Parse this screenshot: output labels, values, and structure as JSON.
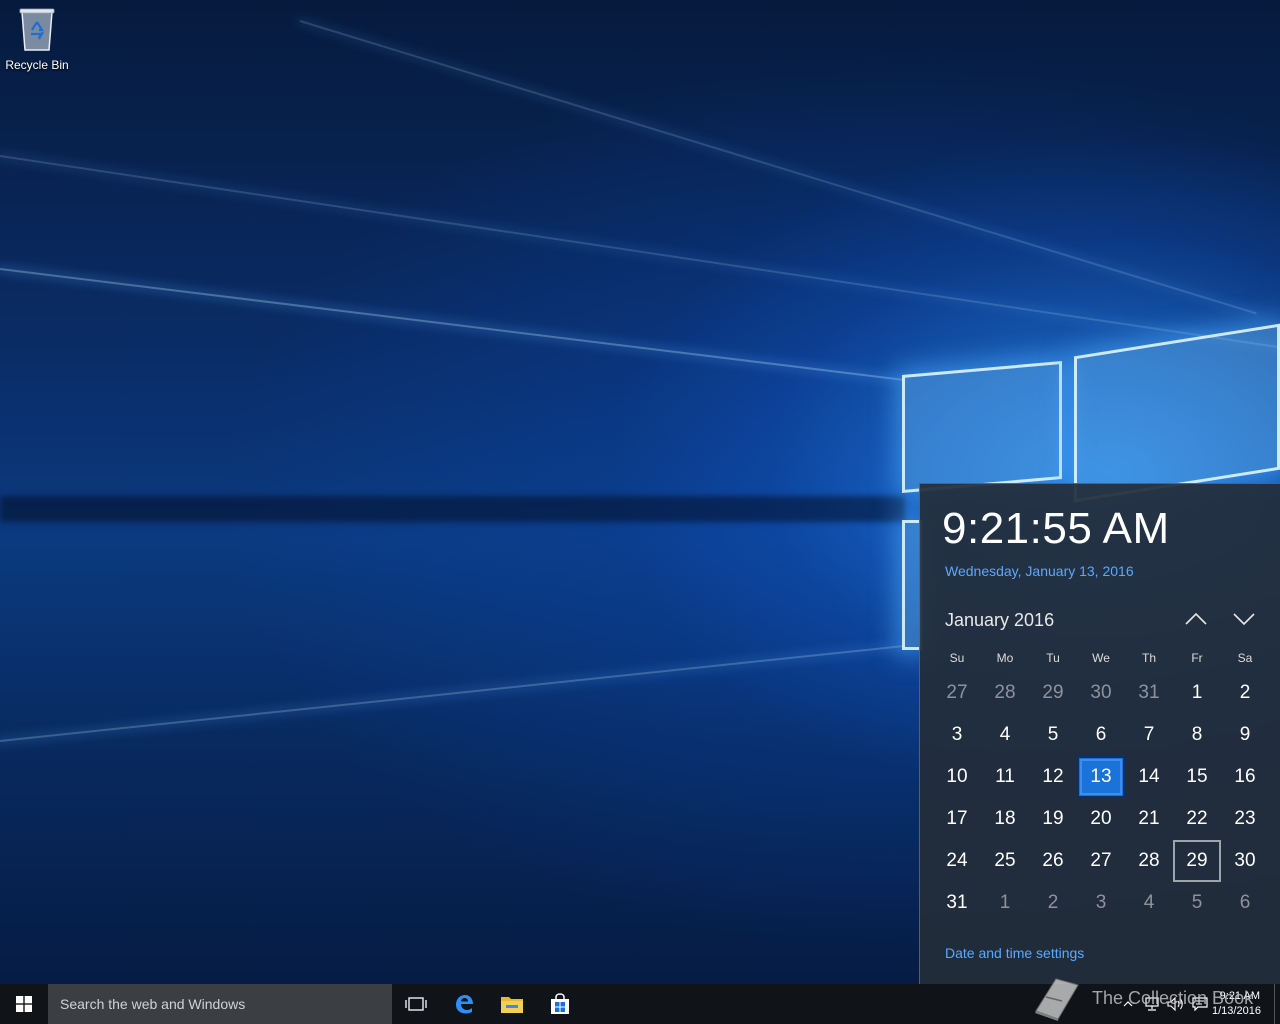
{
  "desktop": {
    "icons": [
      {
        "label": "Recycle Bin",
        "icon": "recycle-bin-icon"
      }
    ]
  },
  "flyout": {
    "time": "9:21:55 AM",
    "date_long": "Wednesday, January 13, 2016",
    "month_title": "January 2016",
    "weekdays": [
      "Su",
      "Mo",
      "Tu",
      "We",
      "Th",
      "Fr",
      "Sa"
    ],
    "weeks": [
      [
        "27",
        "28",
        "29",
        "30",
        "31",
        "1",
        "2"
      ],
      [
        "3",
        "4",
        "5",
        "6",
        "7",
        "8",
        "9"
      ],
      [
        "10",
        "11",
        "12",
        "13",
        "14",
        "15",
        "16"
      ],
      [
        "17",
        "18",
        "19",
        "20",
        "21",
        "22",
        "23"
      ],
      [
        "24",
        "25",
        "26",
        "27",
        "28",
        "29",
        "30"
      ],
      [
        "31",
        "1",
        "2",
        "3",
        "4",
        "5",
        "6"
      ]
    ],
    "selected_day": "13",
    "outlined_day": "29",
    "settings_link": "Date and time settings",
    "accent_color": "#1a73d9",
    "link_color": "#5aa9ff"
  },
  "taskbar": {
    "search_placeholder": "Search the web and Windows",
    "pinned": [
      {
        "name": "task-view-icon"
      },
      {
        "name": "edge-icon"
      },
      {
        "name": "file-explorer-icon"
      },
      {
        "name": "store-icon"
      }
    ],
    "clock_time": "9:21 AM",
    "clock_date": "1/13/2016"
  },
  "watermark": {
    "text": "The Collection Book"
  }
}
